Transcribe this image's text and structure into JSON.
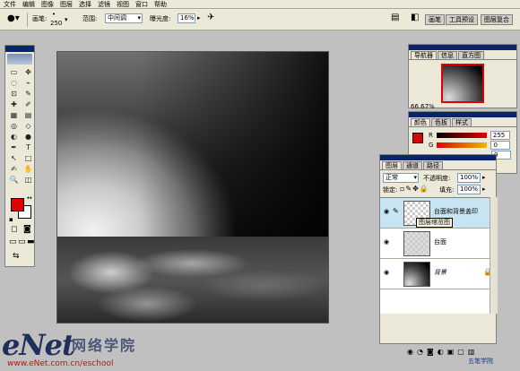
{
  "menubar": {
    "items": [
      "文件",
      "编辑",
      "图像",
      "图层",
      "选择",
      "滤镜",
      "视图",
      "窗口",
      "帮助"
    ]
  },
  "options": {
    "brush_label": "画笔:",
    "brush_size": "250",
    "range_label": "范围:",
    "range_value": "中间调",
    "exposure_label": "曝光度:",
    "exposure_value": "16%",
    "dock_tabs": [
      "画笔",
      "工具预设",
      "图层复合"
    ]
  },
  "toolbox": {
    "tools": [
      "▭",
      "✥",
      "◌",
      "⌁",
      "⊡",
      "✎",
      "✚",
      "✐",
      "▦",
      "▤",
      "◎",
      "◇",
      "◐",
      "●",
      "✒",
      "T",
      "↖",
      "□",
      "✍",
      "✋",
      "🔍",
      "◫"
    ]
  },
  "navigator": {
    "tabs": [
      "导航器",
      "信息",
      "直方图"
    ],
    "zoom": "66.67%"
  },
  "color_panel": {
    "tabs": [
      "颜色",
      "色板",
      "样式"
    ],
    "r_label": "R",
    "g_label": "G",
    "r_value": "255",
    "g_value": "0",
    "b_value": "0",
    "fg_color": "#e00000"
  },
  "layers": {
    "tabs": [
      "图层",
      "通道",
      "路径"
    ],
    "blend_mode": "正常",
    "opacity_label": "不透明度:",
    "opacity_value": "100%",
    "lock_label": "锁定:",
    "fill_label": "填充:",
    "fill_value": "100%",
    "rows": [
      {
        "name": "台面和背景盖印",
        "tooltip": "图层缩览图"
      },
      {
        "name": "台面"
      },
      {
        "name": "背景"
      }
    ]
  },
  "watermark": {
    "brand": "eNet",
    "cn": "网络学院",
    "url": "www.eNet.com.cn/eschool",
    "right": "五笔学院"
  }
}
